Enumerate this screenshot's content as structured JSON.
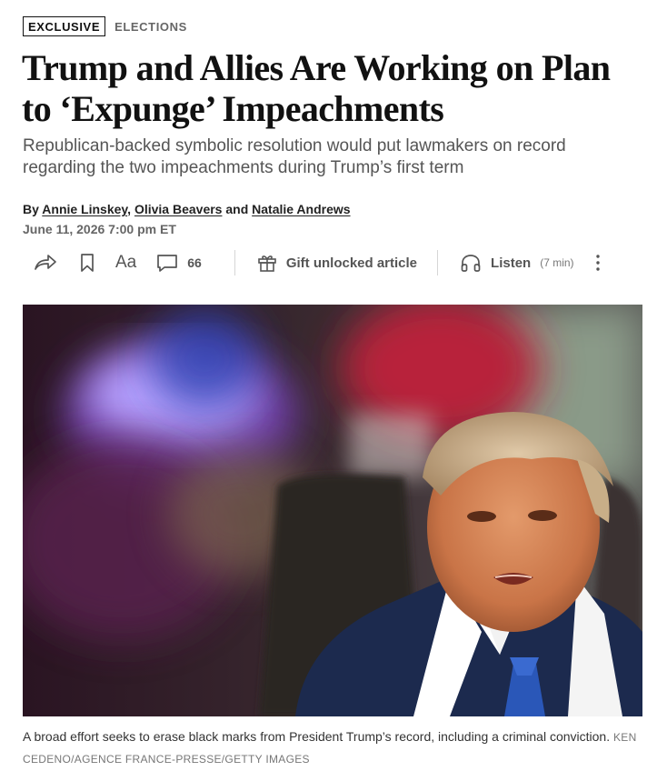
{
  "article": {
    "badge": "EXCLUSIVE",
    "section": "ELECTIONS",
    "headline": "Trump and Allies Are Working on Plan to ‘Expunge’ Impeachments",
    "dek": "Republican-backed symbolic resolution would put lawmakers on record regarding the two impeachments during Trump’s first term",
    "byline": {
      "prefix": "By",
      "authors": [
        "Annie Linskey",
        "Olivia Beavers",
        "Natalie Andrews"
      ],
      "sep1": ",",
      "conj": "and"
    },
    "date": "June 11, 2026 7:00 pm ET"
  },
  "toolbar": {
    "share_icon": "share-arrow-icon",
    "bookmark_icon": "bookmark-icon",
    "text_size_label": "Aa",
    "comments_icon": "comment-bubble-icon",
    "comments_count": "66",
    "gift_icon": "gift-icon",
    "gift_label": "Gift unlocked article",
    "listen_icon": "headphones-icon",
    "listen_label": "Listen",
    "listen_duration": "(7 min)",
    "more_icon": "vertical-ellipsis-icon"
  },
  "photo": {
    "caption": "A broad effort seeks to erase black marks from President Trump’s record, including a criminal conviction.",
    "credit": "KEN CEDENO/AGENCE FRANCE-PRESSE/GETTY IMAGES"
  },
  "colors": {
    "text": "#111111",
    "muted": "#555555",
    "date": "#666666",
    "suit": "#1c2a4e",
    "tie": "#2a57b8",
    "skin": "#d98a5e"
  }
}
